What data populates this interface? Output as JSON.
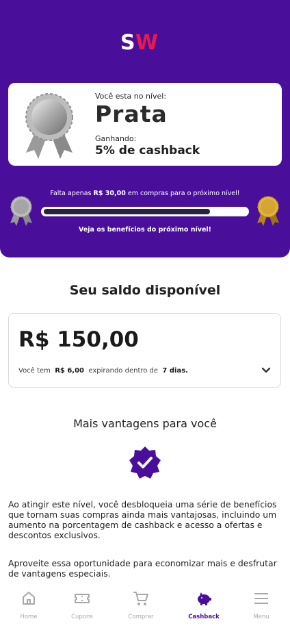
{
  "logo": {
    "text": "SW"
  },
  "level": {
    "label": "Você esta no nível:",
    "name": "Prata",
    "earning_label": "Ganhando:",
    "earning_value": "5% de cashback"
  },
  "progress": {
    "text_prefix": "Falta apenas",
    "amount": "R$ 30,00",
    "text_suffix": "em compras para o próximo nível!",
    "fraction": 0.82,
    "next_level_link": "Veja os benefícios do próximo nível!"
  },
  "balance": {
    "title": "Seu saldo disponível",
    "amount": "R$ 150,00",
    "expiring_prefix": "Você tem",
    "expiring_amount": "R$ 6,00",
    "expiring_middle": "expirando dentro de",
    "expiring_days": "7 dias."
  },
  "perks": {
    "title": "Mais vantagens para você",
    "paragraph1": "Ao atingir este nível, você desbloqueia uma série de benefícios que tornam suas compras ainda mais vantajosas, incluindo um aumento na porcentagem de cashback e acesso a ofertas e descontos exclusivos.",
    "paragraph2": "Aproveite essa oportunidade para economizar mais e desfrutar de vantagens especiais."
  },
  "nav": {
    "items": [
      {
        "label": "Home",
        "icon": "home-icon"
      },
      {
        "label": "Cupons",
        "icon": "ticket-icon"
      },
      {
        "label": "Comprar",
        "icon": "cart-icon"
      },
      {
        "label": "Cashback",
        "icon": "piggy-bank-icon",
        "active": true
      },
      {
        "label": "Menu",
        "icon": "menu-icon"
      }
    ]
  },
  "colors": {
    "brand_purple": "#4a0f9a",
    "logo_pink": "#e8194f",
    "silver": "#b5b5b5",
    "gold": "#d4a530"
  }
}
